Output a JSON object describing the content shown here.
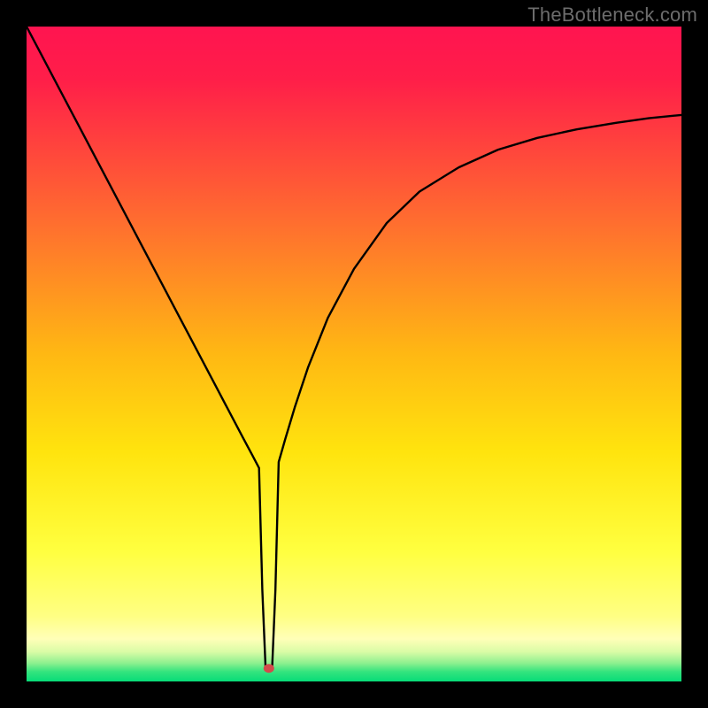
{
  "watermark": "TheBottleneck.com",
  "chart_data": {
    "type": "line",
    "title": "",
    "xlabel": "",
    "ylabel": "",
    "xlim": [
      0,
      100
    ],
    "ylim": [
      0,
      100
    ],
    "background_gradient": {
      "stops": [
        {
          "offset": 0.0,
          "color": "#ff1450"
        },
        {
          "offset": 0.08,
          "color": "#ff1e49"
        },
        {
          "offset": 0.3,
          "color": "#ff6e2f"
        },
        {
          "offset": 0.5,
          "color": "#ffb813"
        },
        {
          "offset": 0.65,
          "color": "#ffe40e"
        },
        {
          "offset": 0.8,
          "color": "#ffff3f"
        },
        {
          "offset": 0.9,
          "color": "#ffff83"
        },
        {
          "offset": 0.935,
          "color": "#ffffb8"
        },
        {
          "offset": 0.955,
          "color": "#d9fca6"
        },
        {
          "offset": 0.972,
          "color": "#8df08f"
        },
        {
          "offset": 0.985,
          "color": "#35e47e"
        },
        {
          "offset": 1.0,
          "color": "#07dc78"
        }
      ]
    },
    "series": [
      {
        "name": "bottleneck-curve",
        "color": "#000000",
        "x": [
          0,
          2,
          5,
          8,
          11,
          14,
          17,
          20,
          23,
          26,
          29,
          31,
          33,
          34.5,
          35.5,
          36,
          36.5,
          37.5,
          38,
          38.5,
          39.5,
          41,
          43,
          46,
          50,
          55,
          60,
          66,
          72,
          78,
          84,
          90,
          95,
          100
        ],
        "y": [
          100,
          96.2,
          90.5,
          84.8,
          79.1,
          73.4,
          67.7,
          62.0,
          56.3,
          50.6,
          44.9,
          41.1,
          37.3,
          34.5,
          32.6,
          14.0,
          2.0,
          2.0,
          14.0,
          33.5,
          37.0,
          42.0,
          48.0,
          55.5,
          63.0,
          70.0,
          74.8,
          78.5,
          81.2,
          83.0,
          84.3,
          85.3,
          86.0,
          86.5
        ]
      }
    ],
    "marker": {
      "name": "optimum-point",
      "x": 37,
      "y": 2,
      "rx": 6,
      "ry": 5,
      "color": "#d24b4b"
    }
  }
}
